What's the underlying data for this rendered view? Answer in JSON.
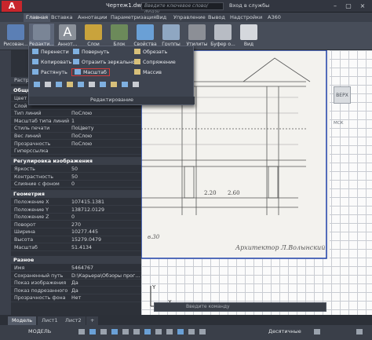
{
  "title": {
    "doc": "Чертеж1.dwg",
    "search_placeholder": "Введите ключевое слово/фразу",
    "signin": "Вход в службы",
    "controls": [
      "–",
      "▢",
      "×"
    ]
  },
  "tabs": [
    "Главная",
    "Вставка",
    "Аннотации",
    "Параметризация",
    "Вид",
    "Управление",
    "Вывод",
    "Надстройки",
    "A360"
  ],
  "ribbon_buttons": [
    "Рисован...",
    "Редакти...",
    "Аннот...",
    "Слои",
    "Блок",
    "Свойства",
    "Группы",
    "Утилиты",
    "Буфер о...",
    "Вид"
  ],
  "edit_menu": {
    "col1": [
      "Перенести",
      "Копировать",
      "Растянуть"
    ],
    "col2": [
      "Повернуть",
      "Отразить зеркально",
      "Масштаб"
    ],
    "col3": [
      "Обрезать",
      "Сопряжение",
      "Массив"
    ],
    "footer": "Редактирование"
  },
  "props": {
    "top_row": "Растро...",
    "general_header": "Общие",
    "general_rows": [
      {
        "k": "Цвет",
        "v": ""
      },
      {
        "k": "Слой",
        "v": ""
      },
      {
        "k": "Тип линий",
        "v": "ПоСлою"
      },
      {
        "k": "Масштаб типа линий",
        "v": "1"
      },
      {
        "k": "Стиль печати",
        "v": "ПоЦвету"
      },
      {
        "k": "Вес линий",
        "v": "ПоСлою"
      },
      {
        "k": "Прозрачность",
        "v": "ПоСлою"
      },
      {
        "k": "Гиперссылка",
        "v": ""
      }
    ],
    "image_header": "Регулировка изображения",
    "image_rows": [
      {
        "k": "Яркость",
        "v": "50"
      },
      {
        "k": "Контрастность",
        "v": "50"
      },
      {
        "k": "Слияние с фоном",
        "v": "0"
      }
    ],
    "geometry_header": "Геометрия",
    "geometry_rows": [
      {
        "k": "Положение X",
        "v": "107415.1381"
      },
      {
        "k": "Положение Y",
        "v": "138712.0129"
      },
      {
        "k": "Положение Z",
        "v": "0"
      },
      {
        "k": "Поворот",
        "v": "270"
      },
      {
        "k": "Ширина",
        "v": "10277.445"
      },
      {
        "k": "Высота",
        "v": "15279.0479"
      },
      {
        "k": "Масштаб",
        "v": "51.4134"
      }
    ],
    "misc_header": "Разное",
    "misc_rows": [
      {
        "k": "Имя",
        "v": "5464767"
      },
      {
        "k": "Сохраненный путь",
        "v": "D:\\Карьера\\Обзоры прог..."
      },
      {
        "k": "Показ изображения",
        "v": "Да"
      },
      {
        "k": "Показ подрезанного",
        "v": "Да"
      },
      {
        "k": "Прозрачность фона",
        "v": "Нет"
      }
    ]
  },
  "drawing": {
    "signature": "Архитектор Л.Волынский",
    "dim1": "2.20",
    "dim2": "2.60",
    "scale_text": "в.30"
  },
  "viewcube": {
    "face": "ВЕРХ",
    "wcs": "МСК"
  },
  "command_placeholder": "Введите команду",
  "axis": {
    "y": "Y",
    "x": "X"
  },
  "layout_tabs": [
    "Модель",
    "Лист1",
    "Лист2"
  ],
  "status": {
    "model": "МОДЕЛЬ",
    "units": "Десятичные"
  },
  "colors": {
    "accent": "#d33b3b",
    "ribbon": "#474d59",
    "panel": "#2d3139"
  }
}
